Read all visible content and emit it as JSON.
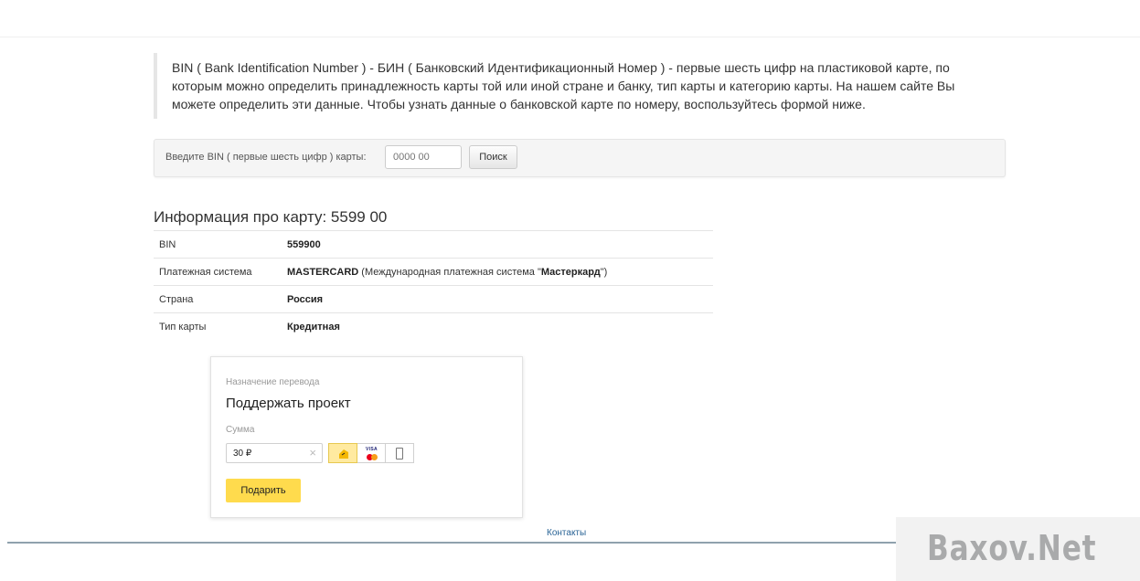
{
  "intro": {
    "text": "BIN ( Bank Identification Number ) - БИН ( Банковский Идентификационный Номер ) - первые шесть цифр на пластиковой карте, по которым можно определить принадлежность карты той или иной стране и банку, тип карты и категорию карты. На нашем сайте Вы можете определить эти данные. Чтобы узнать данные о банковской карте по номеру, воспользуйтесь формой ниже."
  },
  "search": {
    "label": "Введите BIN ( первые шесть цифр ) карты:",
    "placeholder": "0000 00",
    "button_label": "Поиск"
  },
  "info": {
    "title": "Информация про карту: 5599 00",
    "rows": [
      {
        "key": "BIN",
        "value_bold": "559900",
        "value_rest": "",
        "value_bold2": "",
        "value_tail": ""
      },
      {
        "key": "Платежная система",
        "value_bold": "MASTERCARD",
        "value_rest": " (Международная платежная система \"",
        "value_bold2": "Мастеркард",
        "value_tail": "\")"
      },
      {
        "key": "Страна",
        "value_bold": "Россия",
        "value_rest": "",
        "value_bold2": "",
        "value_tail": ""
      },
      {
        "key": "Тип карты",
        "value_bold": "Кредитная",
        "value_rest": "",
        "value_bold2": "",
        "value_tail": ""
      }
    ]
  },
  "donate_widget": {
    "purpose_label": "Назначение перевода",
    "purpose": "Поддержать проект",
    "sum_label": "Сумма",
    "amount": "30 ₽",
    "clear_glyph": "×",
    "payment_methods": [
      {
        "icon": "yandex-money-icon",
        "active": true
      },
      {
        "icon": "visa-mastercard-icon",
        "text": "VISA",
        "active": false
      },
      {
        "icon": "mobile-phone-icon",
        "active": false
      }
    ],
    "donate_button": "Подарить"
  },
  "footer": {
    "contacts_link": "Контакты"
  },
  "watermark": "Baxov.Net",
  "colors": {
    "accent_yellow": "#ffdb4d",
    "link": "#2a6496",
    "active_method_bg": "#ffeaa0"
  }
}
